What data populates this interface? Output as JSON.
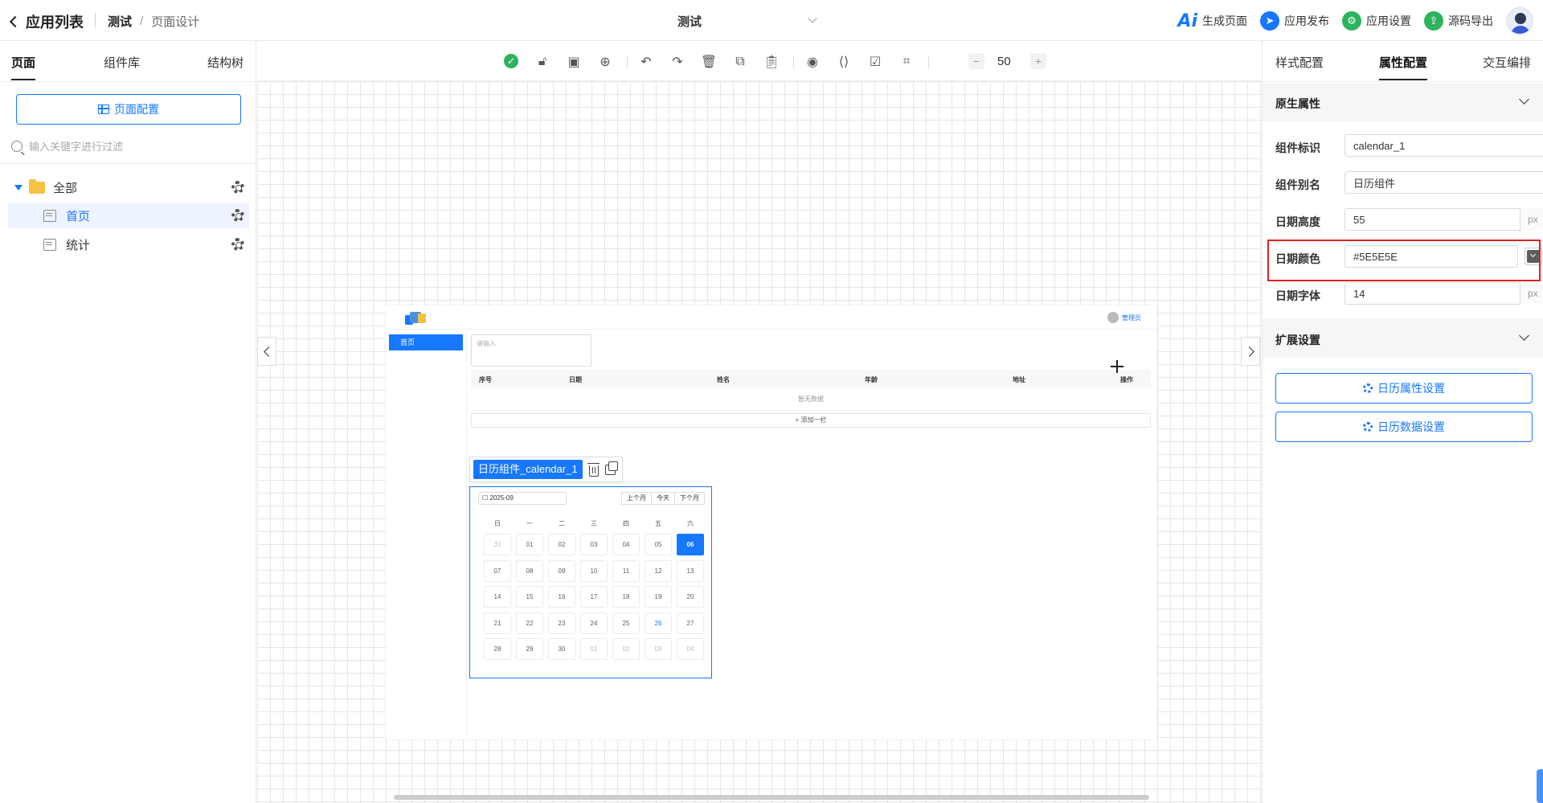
{
  "topbar": {
    "back_label": "应用列表",
    "crumb_app": "测试",
    "crumb_sep": "/",
    "crumb_page": "页面设计",
    "center_title": "测试",
    "actions": {
      "generate": "生成页面",
      "publish": "应用发布",
      "settings": "应用设置",
      "export": "源码导出"
    },
    "ai_text": "Ai"
  },
  "left": {
    "tabs": [
      "页面",
      "组件库",
      "结构树"
    ],
    "page_config_btn": "页面配置",
    "search_placeholder": "输入关键字进行过滤",
    "tree": {
      "root": "全部",
      "items": [
        "首页",
        "统计"
      ]
    }
  },
  "toolbar": {
    "zoom_value": "50",
    "zoom_minus": "−",
    "zoom_plus": "+"
  },
  "preview": {
    "user_label": "管理员",
    "menu_item": "首页",
    "input_placeholder": "请输入",
    "table_headers": [
      "序号",
      "日期",
      "姓名",
      "年龄",
      "地址",
      "操作"
    ],
    "empty_text": "暂无数据",
    "add_column": "+ 添加一栏"
  },
  "component": {
    "label": "日历组件_calendar_1",
    "calendar": {
      "month": "2025-09",
      "prev": "上个月",
      "today": "今天",
      "next": "下个月",
      "weekdays": [
        "日",
        "一",
        "二",
        "三",
        "四",
        "五",
        "六"
      ],
      "days": [
        [
          "31",
          "01",
          "02",
          "03",
          "04",
          "05",
          "06"
        ],
        [
          "07",
          "08",
          "09",
          "10",
          "11",
          "12",
          "13"
        ],
        [
          "14",
          "15",
          "16",
          "17",
          "18",
          "19",
          "20"
        ],
        [
          "21",
          "22",
          "23",
          "24",
          "25",
          "26",
          "27"
        ],
        [
          "28",
          "29",
          "30",
          "01",
          "02",
          "03",
          "04"
        ]
      ],
      "today_value": "06",
      "accent_value": "26",
      "date_color": "#5E5E5E",
      "accent_color": "#1677ff"
    }
  },
  "right": {
    "tabs": [
      "样式配置",
      "属性配置",
      "交互编排"
    ],
    "section_native": "原生属性",
    "section_ext": "扩展设置",
    "props": {
      "id_label": "组件标识",
      "id_value": "calendar_1",
      "alias_label": "组件别名",
      "alias_value": "日历组件",
      "height_label": "日期高度",
      "height_value": "55",
      "color_label": "日期颜色",
      "color_value": "#5E5E5E",
      "font_label": "日期字体",
      "font_value": "14",
      "unit": "px"
    },
    "btn_attr": "日历属性设置",
    "btn_data": "日历数据设置"
  }
}
